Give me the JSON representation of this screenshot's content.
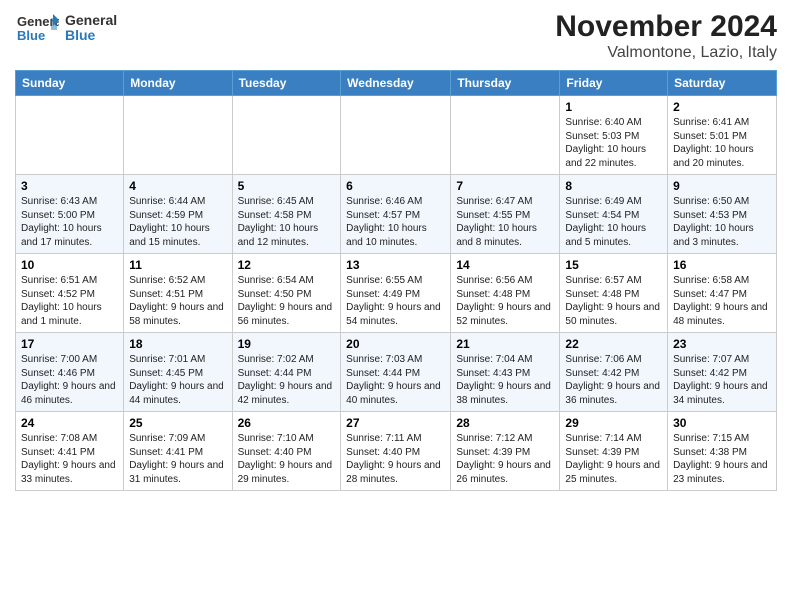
{
  "logo": {
    "line1": "General",
    "line2": "Blue"
  },
  "title": "November 2024",
  "subtitle": "Valmontone, Lazio, Italy",
  "weekdays": [
    "Sunday",
    "Monday",
    "Tuesday",
    "Wednesday",
    "Thursday",
    "Friday",
    "Saturday"
  ],
  "weeks": [
    [
      {
        "day": "",
        "info": ""
      },
      {
        "day": "",
        "info": ""
      },
      {
        "day": "",
        "info": ""
      },
      {
        "day": "",
        "info": ""
      },
      {
        "day": "",
        "info": ""
      },
      {
        "day": "1",
        "info": "Sunrise: 6:40 AM\nSunset: 5:03 PM\nDaylight: 10 hours and 22 minutes."
      },
      {
        "day": "2",
        "info": "Sunrise: 6:41 AM\nSunset: 5:01 PM\nDaylight: 10 hours and 20 minutes."
      }
    ],
    [
      {
        "day": "3",
        "info": "Sunrise: 6:43 AM\nSunset: 5:00 PM\nDaylight: 10 hours and 17 minutes."
      },
      {
        "day": "4",
        "info": "Sunrise: 6:44 AM\nSunset: 4:59 PM\nDaylight: 10 hours and 15 minutes."
      },
      {
        "day": "5",
        "info": "Sunrise: 6:45 AM\nSunset: 4:58 PM\nDaylight: 10 hours and 12 minutes."
      },
      {
        "day": "6",
        "info": "Sunrise: 6:46 AM\nSunset: 4:57 PM\nDaylight: 10 hours and 10 minutes."
      },
      {
        "day": "7",
        "info": "Sunrise: 6:47 AM\nSunset: 4:55 PM\nDaylight: 10 hours and 8 minutes."
      },
      {
        "day": "8",
        "info": "Sunrise: 6:49 AM\nSunset: 4:54 PM\nDaylight: 10 hours and 5 minutes."
      },
      {
        "day": "9",
        "info": "Sunrise: 6:50 AM\nSunset: 4:53 PM\nDaylight: 10 hours and 3 minutes."
      }
    ],
    [
      {
        "day": "10",
        "info": "Sunrise: 6:51 AM\nSunset: 4:52 PM\nDaylight: 10 hours and 1 minute."
      },
      {
        "day": "11",
        "info": "Sunrise: 6:52 AM\nSunset: 4:51 PM\nDaylight: 9 hours and 58 minutes."
      },
      {
        "day": "12",
        "info": "Sunrise: 6:54 AM\nSunset: 4:50 PM\nDaylight: 9 hours and 56 minutes."
      },
      {
        "day": "13",
        "info": "Sunrise: 6:55 AM\nSunset: 4:49 PM\nDaylight: 9 hours and 54 minutes."
      },
      {
        "day": "14",
        "info": "Sunrise: 6:56 AM\nSunset: 4:48 PM\nDaylight: 9 hours and 52 minutes."
      },
      {
        "day": "15",
        "info": "Sunrise: 6:57 AM\nSunset: 4:48 PM\nDaylight: 9 hours and 50 minutes."
      },
      {
        "day": "16",
        "info": "Sunrise: 6:58 AM\nSunset: 4:47 PM\nDaylight: 9 hours and 48 minutes."
      }
    ],
    [
      {
        "day": "17",
        "info": "Sunrise: 7:00 AM\nSunset: 4:46 PM\nDaylight: 9 hours and 46 minutes."
      },
      {
        "day": "18",
        "info": "Sunrise: 7:01 AM\nSunset: 4:45 PM\nDaylight: 9 hours and 44 minutes."
      },
      {
        "day": "19",
        "info": "Sunrise: 7:02 AM\nSunset: 4:44 PM\nDaylight: 9 hours and 42 minutes."
      },
      {
        "day": "20",
        "info": "Sunrise: 7:03 AM\nSunset: 4:44 PM\nDaylight: 9 hours and 40 minutes."
      },
      {
        "day": "21",
        "info": "Sunrise: 7:04 AM\nSunset: 4:43 PM\nDaylight: 9 hours and 38 minutes."
      },
      {
        "day": "22",
        "info": "Sunrise: 7:06 AM\nSunset: 4:42 PM\nDaylight: 9 hours and 36 minutes."
      },
      {
        "day": "23",
        "info": "Sunrise: 7:07 AM\nSunset: 4:42 PM\nDaylight: 9 hours and 34 minutes."
      }
    ],
    [
      {
        "day": "24",
        "info": "Sunrise: 7:08 AM\nSunset: 4:41 PM\nDaylight: 9 hours and 33 minutes."
      },
      {
        "day": "25",
        "info": "Sunrise: 7:09 AM\nSunset: 4:41 PM\nDaylight: 9 hours and 31 minutes."
      },
      {
        "day": "26",
        "info": "Sunrise: 7:10 AM\nSunset: 4:40 PM\nDaylight: 9 hours and 29 minutes."
      },
      {
        "day": "27",
        "info": "Sunrise: 7:11 AM\nSunset: 4:40 PM\nDaylight: 9 hours and 28 minutes."
      },
      {
        "day": "28",
        "info": "Sunrise: 7:12 AM\nSunset: 4:39 PM\nDaylight: 9 hours and 26 minutes."
      },
      {
        "day": "29",
        "info": "Sunrise: 7:14 AM\nSunset: 4:39 PM\nDaylight: 9 hours and 25 minutes."
      },
      {
        "day": "30",
        "info": "Sunrise: 7:15 AM\nSunset: 4:38 PM\nDaylight: 9 hours and 23 minutes."
      }
    ]
  ]
}
